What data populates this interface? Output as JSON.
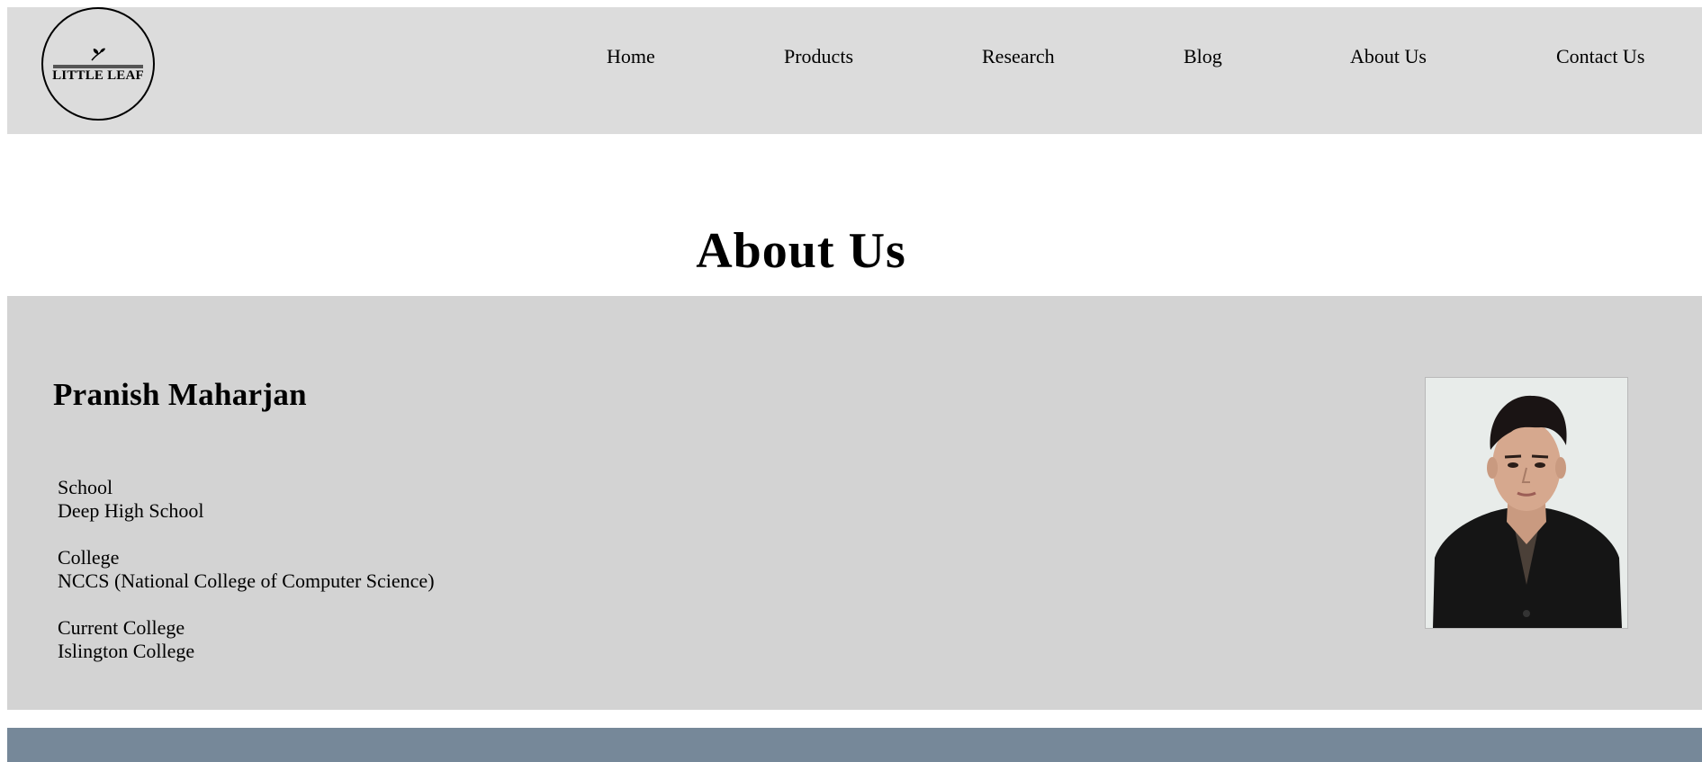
{
  "logo": {
    "text": "LITTLE LEAF"
  },
  "nav": {
    "items": [
      {
        "label": "Home"
      },
      {
        "label": "Products"
      },
      {
        "label": "Research"
      },
      {
        "label": "Blog"
      },
      {
        "label": "About Us"
      },
      {
        "label": "Contact Us"
      }
    ]
  },
  "page": {
    "title": "About Us"
  },
  "profile": {
    "name": "Pranish Maharjan",
    "education": [
      {
        "label": "School",
        "value": "Deep High School"
      },
      {
        "label": "College",
        "value": "NCCS (National College of Computer Science)"
      },
      {
        "label": "Current College",
        "value": "Islington College"
      }
    ],
    "photo_icon": "portrait-photo"
  },
  "colors": {
    "navbar_bg": "#dcdcdc",
    "section_bg": "#d3d3d3",
    "footer_bg": "#768899"
  }
}
